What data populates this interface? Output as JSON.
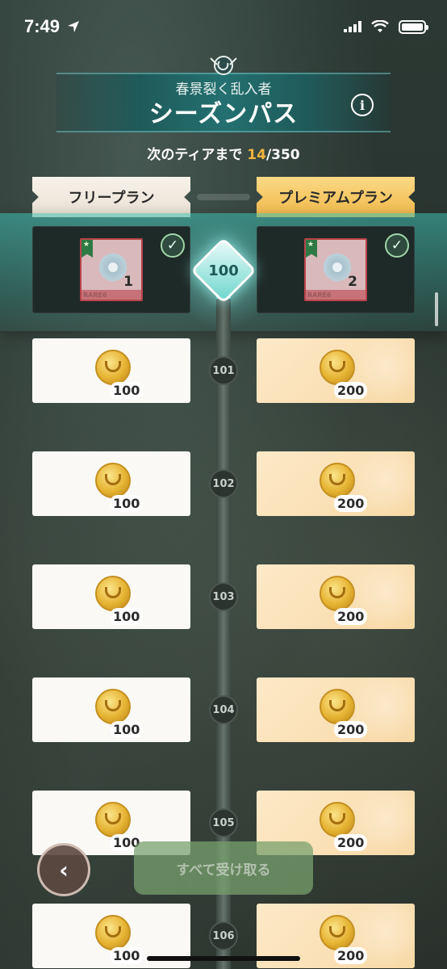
{
  "status_bar": {
    "time": "7:49",
    "location_icon": "location-arrow-icon",
    "signal_icon": "cellular-signal-icon",
    "wifi_icon": "wifi-icon",
    "battery_icon": "battery-icon"
  },
  "header": {
    "emblem_icon": "season-emblem-icon",
    "subtitle": "春景裂く乱入者",
    "title": "シーズンパス",
    "info_icon": "info-icon",
    "info_label": "i"
  },
  "progress": {
    "prefix": "次のティアまで ",
    "current": "14",
    "separator_total": "/350"
  },
  "plans": {
    "free_label": "フリープラン",
    "premium_label": "プレミアムプラン"
  },
  "current_tier": {
    "tier": "100",
    "free_reward": {
      "rarity": "RARE6",
      "count": "1",
      "claimed": true
    },
    "premium_reward": {
      "rarity": "RARE6",
      "count": "2",
      "claimed": true
    }
  },
  "tiers": [
    {
      "tier": "101",
      "free_amount": "100",
      "premium_amount": "200"
    },
    {
      "tier": "102",
      "free_amount": "100",
      "premium_amount": "200"
    },
    {
      "tier": "103",
      "free_amount": "100",
      "premium_amount": "200"
    },
    {
      "tier": "104",
      "free_amount": "100",
      "premium_amount": "200"
    },
    {
      "tier": "105",
      "free_amount": "100",
      "premium_amount": "200"
    },
    {
      "tier": "106",
      "free_amount": "100",
      "premium_amount": "200"
    }
  ],
  "controls": {
    "back_label": "‹",
    "claim_all_label": "すべて受け取る"
  },
  "colors": {
    "accent_teal": "#247070",
    "tier_highlight": "#f2b33d",
    "premium_gold": "#f0b94a"
  }
}
